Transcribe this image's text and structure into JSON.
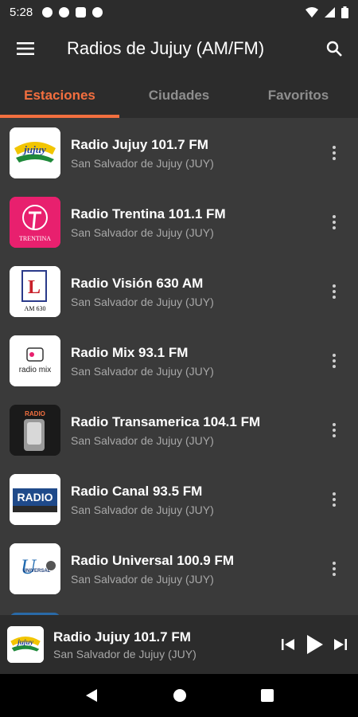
{
  "status_bar": {
    "time": "5:28"
  },
  "app_bar": {
    "title": "Radios de Jujuy (AM/FM)"
  },
  "tabs": [
    {
      "label": "Estaciones",
      "active": true
    },
    {
      "label": "Ciudades",
      "active": false
    },
    {
      "label": "Favoritos",
      "active": false
    }
  ],
  "stations": [
    {
      "name": "Radio Jujuy 101.7 FM",
      "city": "San Salvador de Jujuy (JUY)",
      "logo_text": "jujuy"
    },
    {
      "name": "Radio Trentina 101.1 FM",
      "city": "San Salvador de Jujuy (JUY)",
      "logo_text": "TRENTINA"
    },
    {
      "name": "Radio Visión 630 AM",
      "city": "San Salvador de Jujuy (JUY)",
      "logo_text": "AM 630"
    },
    {
      "name": "Radio Mix 93.1 FM",
      "city": "San Salvador de Jujuy (JUY)",
      "logo_text": "radio mix"
    },
    {
      "name": "Radio Transamerica 104.1 FM",
      "city": "San Salvador de Jujuy (JUY)",
      "logo_text": "RADIO"
    },
    {
      "name": "Radio Canal 93.5 FM",
      "city": "San Salvador de Jujuy (JUY)",
      "logo_text": "RADIO"
    },
    {
      "name": "Radio Universal 100.9 FM",
      "city": "San Salvador de Jujuy (JUY)",
      "logo_text": "UNIVERSAL"
    }
  ],
  "now_playing": {
    "name": "Radio Jujuy 101.7 FM",
    "city": "San Salvador de Jujuy (JUY)",
    "logo_text": "jujuy"
  },
  "colors": {
    "accent": "#f36f3f",
    "background": "#3a3a3a",
    "bar": "#2c2c2c"
  }
}
